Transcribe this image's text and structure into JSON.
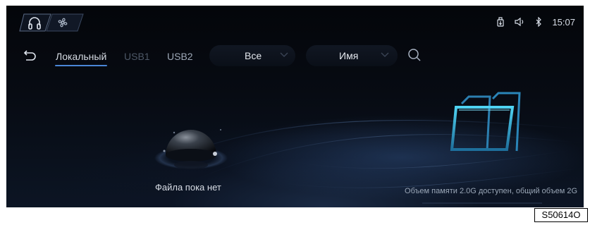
{
  "status_bar": {
    "time": "15:07"
  },
  "toolbar": {
    "tabs": [
      "Локальный",
      "USB1",
      "USB2"
    ],
    "filter_dropdown": "Все",
    "sort_dropdown": "Имя"
  },
  "empty_state": {
    "message": "Файла пока нет",
    "storage": "Объем памяти 2.0G доступен, общий объем 2G"
  },
  "figure_code": "S50614O",
  "colors": {
    "accent": "#4a86d6",
    "background": "#05080e",
    "folder": "#3fc6e8"
  }
}
